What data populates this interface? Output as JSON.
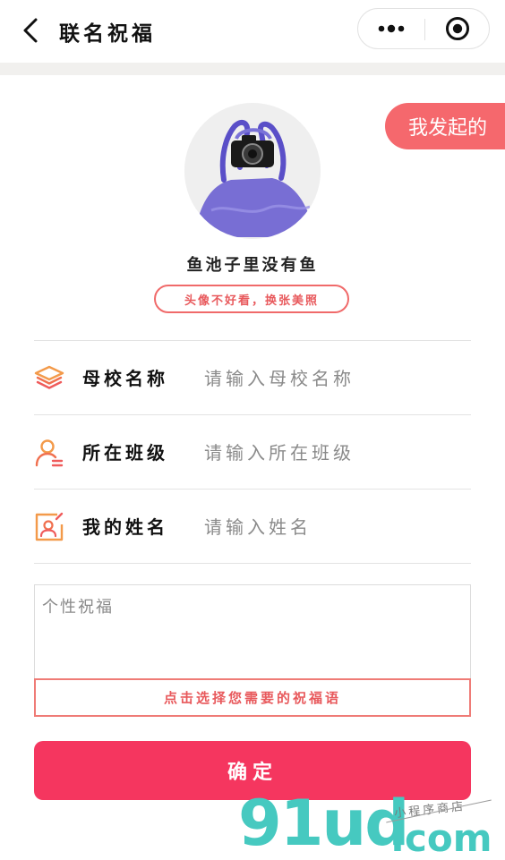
{
  "navbar": {
    "title": "联名祝福",
    "back_icon": "chevron-left-icon",
    "more_icon": "more-dots-icon",
    "close_icon": "target-circle-icon"
  },
  "launched_tag": {
    "label": "我发起的",
    "color": "#f5686d"
  },
  "profile": {
    "nickname": "鱼池子里没有鱼",
    "change_avatar_label": "头像不好看，换张美照"
  },
  "form": {
    "rows": [
      {
        "label": "母校名称",
        "placeholder": "请输入母校名称",
        "value": "",
        "icon": "graduation-cap-icon"
      },
      {
        "label": "所在班级",
        "placeholder": "请输入所在班级",
        "value": "",
        "icon": "user-list-icon"
      },
      {
        "label": "我的姓名",
        "placeholder": "请输入姓名",
        "value": "",
        "icon": "id-card-icon"
      }
    ],
    "wish_placeholder": "个性祝福",
    "wish_value": "",
    "select_wish_label": "点击选择您需要的祝福语",
    "confirm_label": "确定"
  },
  "watermark": {
    "main": "91ud",
    "domain": ".com",
    "sub": "小程序商店"
  },
  "colors": {
    "accent": "#f5365f",
    "accent_soft": "#e8595c",
    "icon_orange": "#f39a4a",
    "icon_red": "#ef5b5b",
    "watermark": "#46c9c0"
  }
}
